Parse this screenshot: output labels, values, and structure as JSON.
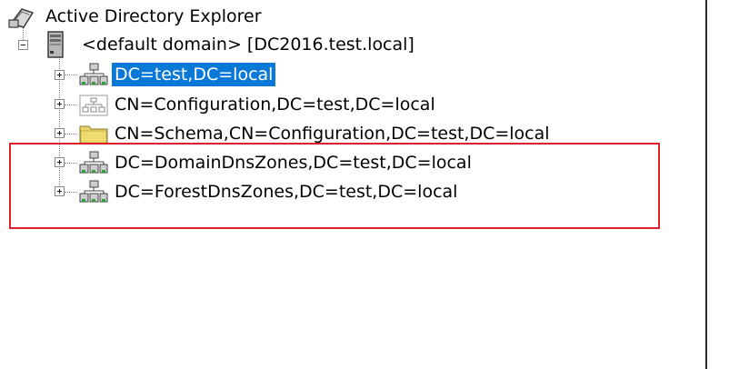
{
  "tree": {
    "root": {
      "label": "Active Directory Explorer",
      "icon": "ad-explorer-icon"
    },
    "server": {
      "label": "<default domain> [DC2016.test.local]",
      "icon": "server-icon",
      "expanded": true
    },
    "nodes": [
      {
        "label": "DC=test,DC=local",
        "icon": "domain-container-icon",
        "selected": true
      },
      {
        "label": "CN=Configuration,DC=test,DC=local",
        "icon": "configuration-icon",
        "selected": false
      },
      {
        "label": "CN=Schema,CN=Configuration,DC=test,DC=local",
        "icon": "folder-icon",
        "selected": false
      },
      {
        "label": "DC=DomainDnsZones,DC=test,DC=local",
        "icon": "domain-container-icon",
        "selected": false
      },
      {
        "label": "DC=ForestDnsZones,DC=test,DC=local",
        "icon": "domain-container-icon",
        "selected": false
      }
    ]
  },
  "colors": {
    "selection": "#0a78d7",
    "highlight": "#d8222b"
  }
}
